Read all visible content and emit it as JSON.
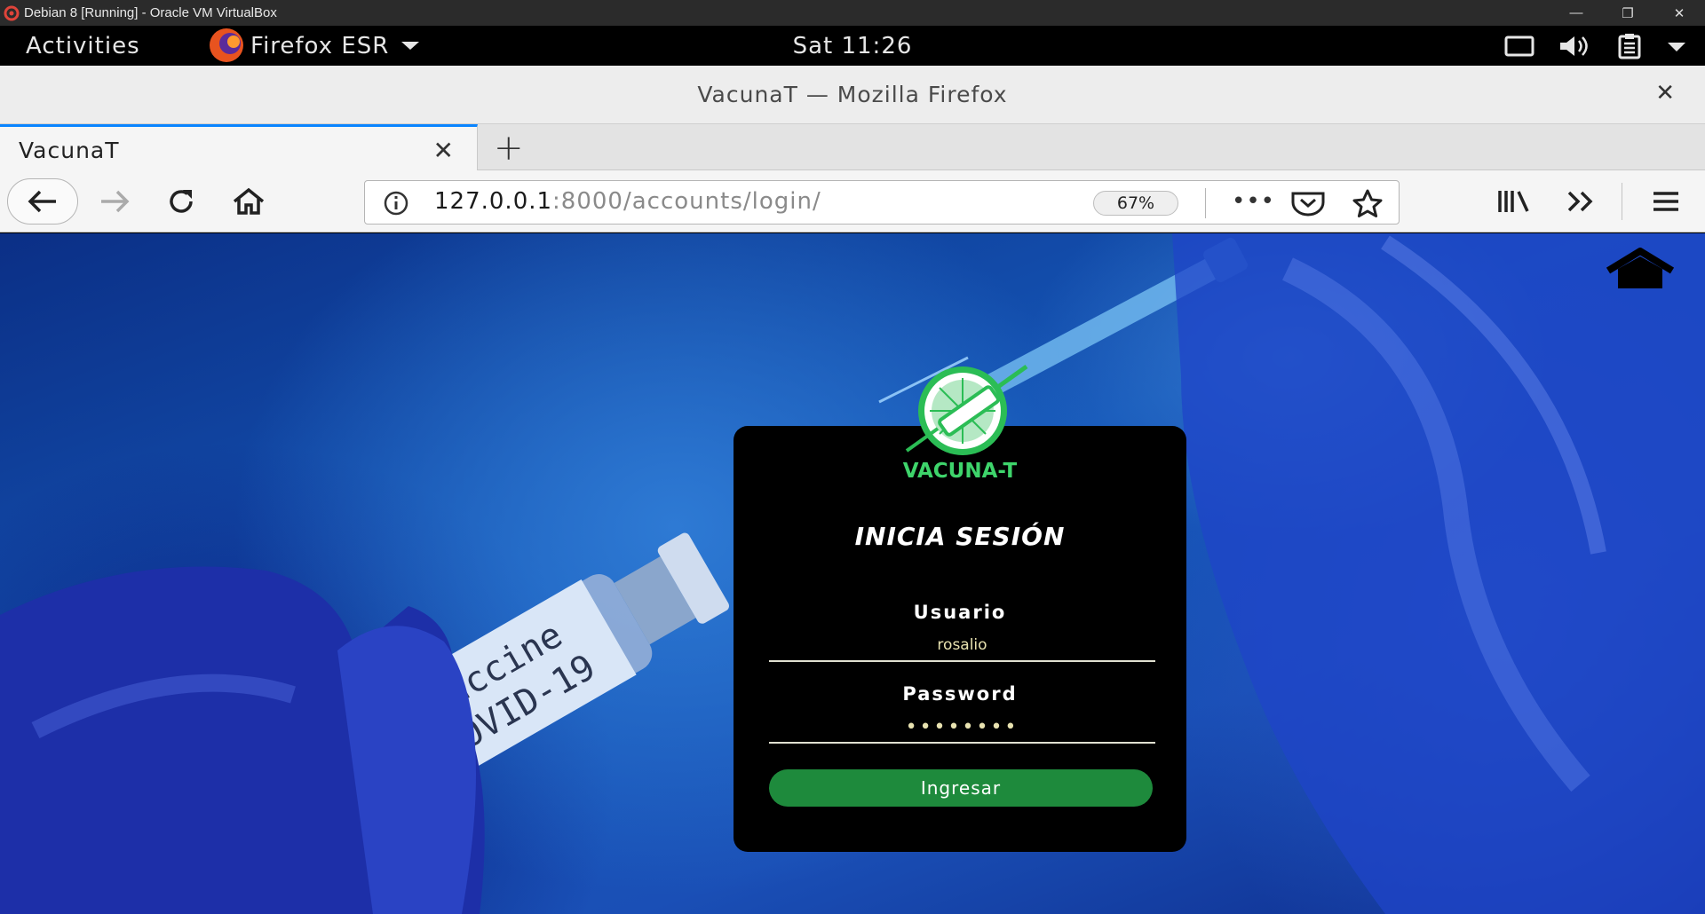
{
  "vbox": {
    "title": "Debian 8 [Running] - Oracle VM VirtualBox",
    "minimize": "—",
    "restore": "❐",
    "close": "✕"
  },
  "gnome": {
    "activities": "Activities",
    "app_name": "Firefox ESR",
    "clock": "Sat 11:26"
  },
  "firefox": {
    "window_title": "VacunaT — Mozilla Firefox",
    "close": "✕",
    "tab": {
      "title": "VacunaT",
      "close": "✕"
    },
    "new_tab": "+",
    "url_host": "127.0.0.1",
    "url_rest": ":8000/accounts/login/",
    "zoom": "67%",
    "page_actions": "•••"
  },
  "login": {
    "brand": "VACUNA-T",
    "heading": "INICIA SESIÓN",
    "username_label": "Usuario",
    "username_value": "rosalio",
    "password_label": "Password",
    "password_value": "rosalio1",
    "submit_label": "Ingresar"
  },
  "scene": {
    "vial_line1": "Vaccine",
    "vial_line2": "COVID-19"
  },
  "colors": {
    "accent_green": "#1e8a3c",
    "brand_green": "#3ed46b",
    "tab_highlight": "#0a84ff"
  },
  "icons": [
    "back-arrow-icon",
    "forward-arrow-icon",
    "reload-icon",
    "home-icon",
    "info-icon",
    "pocket-icon",
    "bookmark-star-icon",
    "library-icon",
    "overflow-chevrons-icon",
    "hamburger-menu-icon",
    "screen-icon",
    "volume-icon",
    "clipboard-icon",
    "firefox-logo-icon",
    "virtualbox-icon"
  ]
}
